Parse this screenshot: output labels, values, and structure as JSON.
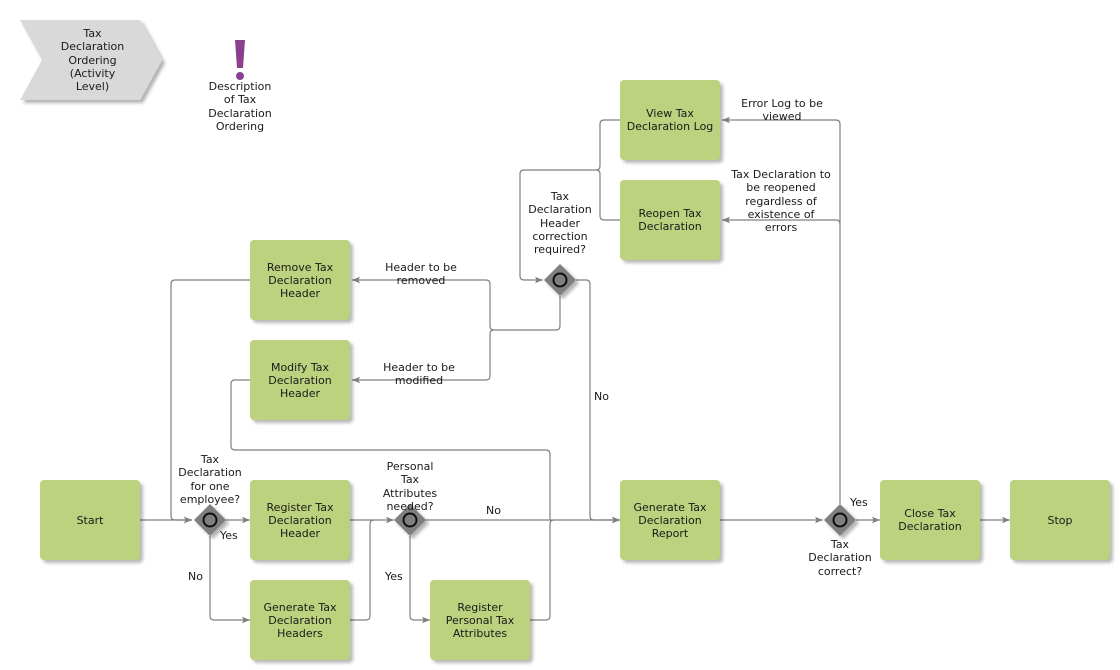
{
  "process_header": {
    "title": "Tax\nDeclaration\nOrdering\n(Activity\nLevel)",
    "description": "Description\nof Tax\nDeclaration\nOrdering"
  },
  "colors": {
    "activity_fill": "#bdd27e",
    "chevron_fill": "#d9d9d9",
    "gateway_fill": "#7f7f7f",
    "connector": "#808080",
    "note_icon": "#8b3f8f"
  },
  "activities": {
    "start": "Start",
    "register_header": "Register Tax Declaration Header",
    "generate_headers": "Generate Tax Declaration Headers",
    "remove_header": "Remove Tax Declaration Header",
    "modify_header": "Modify Tax Declaration Header",
    "register_personal": "Register Personal Tax Attributes",
    "view_log": "View Tax Declaration Log",
    "reopen": "Reopen Tax Declaration",
    "generate_report": "Generate Tax Declaration Report",
    "close": "Close Tax Declaration",
    "stop": "Stop"
  },
  "gateways": {
    "one_employee": "Tax\nDeclaration\nfor one\nemployee?",
    "personal_attrs": "Personal\nTax\nAttributes\nneeded?",
    "header_correction": "Tax\nDeclaration\nHeader\ncorrection\nrequired?",
    "correct": "Tax\nDeclaration\ncorrect?"
  },
  "edge_labels": {
    "yes_register": "Yes",
    "no_generate": "No",
    "no_report": "No",
    "yes_personal": "Yes",
    "no_correction": "No",
    "header_removed": "Header to be\nremoved",
    "header_modified": "Header to be\nmodified",
    "log_viewed": "Error Log to be\nviewed",
    "reopened": "Tax Declaration to\nbe reopened\nregardless of\nexistence of\nerrors",
    "yes_close": "Yes"
  }
}
